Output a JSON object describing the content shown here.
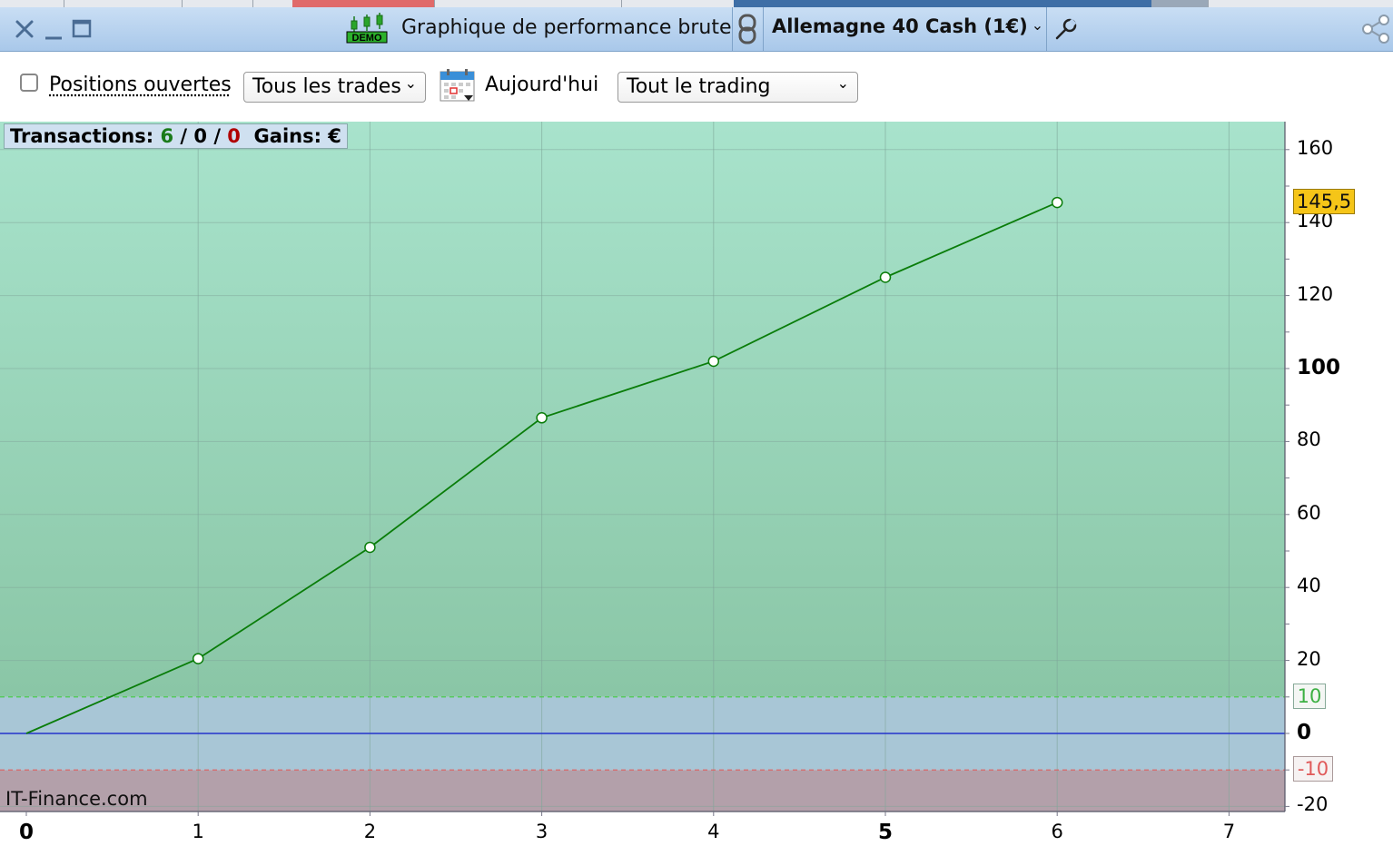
{
  "window": {
    "title": "Graphique de performance brute",
    "instrument": "Allemagne 40 Cash (1€)",
    "demo_badge": "DEMO"
  },
  "toolbar": {
    "open_positions_label": "Positions ouvertes",
    "open_positions_checked": false,
    "trades_filter": "Tous les trades",
    "date_label": "Aujourd'hui",
    "trading_filter": "Tout le trading"
  },
  "stats": {
    "transactions_label": "Transactions:",
    "winning": "6",
    "sep1": "/",
    "neutral": "0",
    "sep2": "/",
    "losing": "0",
    "gains_label": "Gains: €"
  },
  "watermark": "IT-Finance.com",
  "chart_data": {
    "type": "line",
    "x": [
      0,
      1,
      2,
      3,
      4,
      5,
      6
    ],
    "y": [
      0,
      20.5,
      51,
      86.5,
      102,
      125,
      145.5
    ],
    "x_ticks": [
      "0",
      "1",
      "2",
      "3",
      "4",
      "5",
      "6",
      "7"
    ],
    "y_ticks": [
      "160",
      "140",
      "120",
      "100",
      "80",
      "60",
      "40",
      "20",
      "0",
      "-20"
    ],
    "xlim": [
      0,
      7.3
    ],
    "ylim": [
      -22,
      167
    ],
    "last_value_label": "145,5",
    "upper_threshold": 10,
    "upper_threshold_label": "10",
    "lower_threshold": -10,
    "lower_threshold_label": "-10",
    "zero_line": 0,
    "grid": true,
    "colors": {
      "line": "#0a7d0a",
      "upper_zone": "#a8e3cc",
      "neutral_zone": "#a8c6d6",
      "lower_zone": "#b3a0aa",
      "zero_line": "#2233cc",
      "upper_dashed": "#44cc44",
      "lower_dashed": "#e06060",
      "last_value_bg": "#f5c518"
    }
  }
}
